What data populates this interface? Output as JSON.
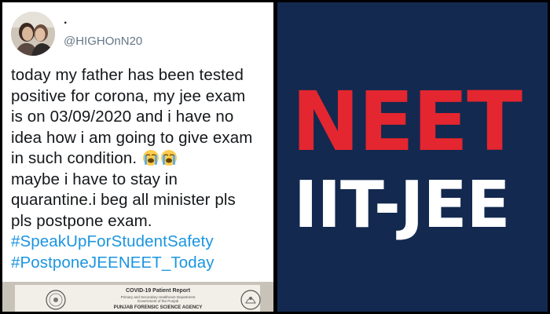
{
  "tweet": {
    "display_name": ".",
    "handle": "@HIGHOnN20",
    "avatar_icon": "profile-photo-avatar",
    "text_lines": [
      "today my father has been tested",
      "positive for corona, my jee exam",
      "is on 03/09/2020 and i have no",
      "idea how i am going to give exam",
      "in such condition.",
      "maybe i have to stay in",
      "quarantine.i beg all minister pls",
      "pls postpone exam."
    ],
    "emoji_icons": [
      "loudly-crying-face-icon",
      "loudly-crying-face-icon"
    ],
    "hashtags": [
      "#SpeakUpForStudentSafety",
      "#PostponeJEENEET_Today"
    ],
    "colors": {
      "text": "#14171a",
      "handle": "#657786",
      "hashtag": "#1b95e0"
    }
  },
  "attached_image": {
    "report_title": "COVID-19 Patient Report",
    "report_subtitle_1": "Primary and Secondary Healthcare Department",
    "report_subtitle_2": "Government of the Punjab",
    "report_agency": "PUNJAB FORENSIC SCIENCE AGENCY"
  },
  "logo": {
    "line1": "NEET",
    "line2": "IIT-JEE",
    "colors": {
      "background": "#13294f",
      "line1": "#e3262f",
      "line2": "#ffffff"
    }
  }
}
